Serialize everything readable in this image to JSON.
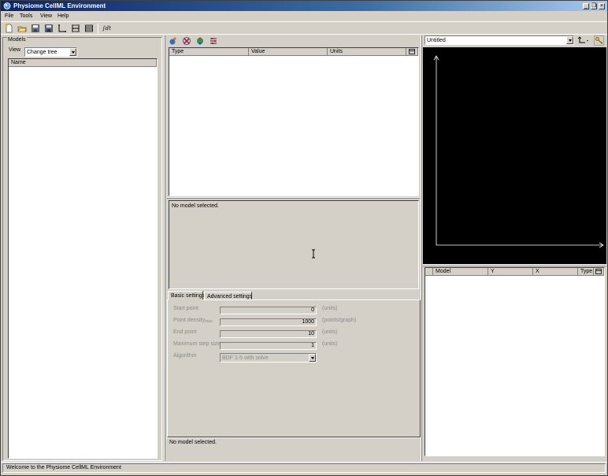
{
  "window": {
    "title": "Physiome CellML Environment",
    "controls": {
      "minimize": "_",
      "restore": "❐",
      "close": "×"
    }
  },
  "menu": {
    "items": [
      {
        "label": "File",
        "icon": "none"
      },
      {
        "label": "Tools",
        "icon": "none"
      },
      {
        "label": "View",
        "icon": "none"
      },
      {
        "label": "Help",
        "icon": "none"
      }
    ]
  },
  "toolbar": {
    "buttons": [
      {
        "name": "new-file-icon"
      },
      {
        "name": "open-folder-icon"
      },
      {
        "name": "save-icon"
      },
      {
        "name": "save-all-icon"
      },
      {
        "name": "axis-icon"
      },
      {
        "name": "fit-icon"
      },
      {
        "name": "fit-all-icon"
      }
    ],
    "integral_label": "∫dt"
  },
  "models_panel": {
    "group_label": "Models",
    "view_label": "View",
    "view_select_value": "Change tree",
    "list_header": "Name"
  },
  "variables_panel": {
    "toolbar_icons": [
      "add-model-icon",
      "remove-icon",
      "refresh-icon",
      "options-icon"
    ],
    "columns": [
      "Type",
      "Value",
      "Units"
    ]
  },
  "info_panel": {
    "message": "No model selected."
  },
  "settings": {
    "tabs": [
      {
        "label": "Basic settings",
        "active": true
      },
      {
        "label": "Advanced settings",
        "active": false
      }
    ],
    "fields": [
      {
        "label": "Start point",
        "sub": "",
        "value": "0",
        "units": "(units)"
      },
      {
        "label": "Point density",
        "sub": "max",
        "value": "1000",
        "units": "(points/graph)"
      },
      {
        "label": "End point",
        "sub": "",
        "value": "10",
        "units": "(units)"
      },
      {
        "label": "Maximum step size",
        "sub": "",
        "value": "1",
        "units": "(units)"
      }
    ],
    "algorithm_label": "Algorithm",
    "algorithm_value": "BDF 1-5 with solve"
  },
  "center_status": "No model selected.",
  "graph_panel": {
    "graph_select_value": "Untitled",
    "axis_button": "axis-dropdown-icon",
    "key_button": "key-icon",
    "background_color": "#000000",
    "axis_color": "#ffffff"
  },
  "traces_table": {
    "columns": [
      "Model",
      "Y",
      "X",
      "Type"
    ]
  },
  "status_bar": {
    "message": "Welcome to the Physiome CellML Environment"
  }
}
